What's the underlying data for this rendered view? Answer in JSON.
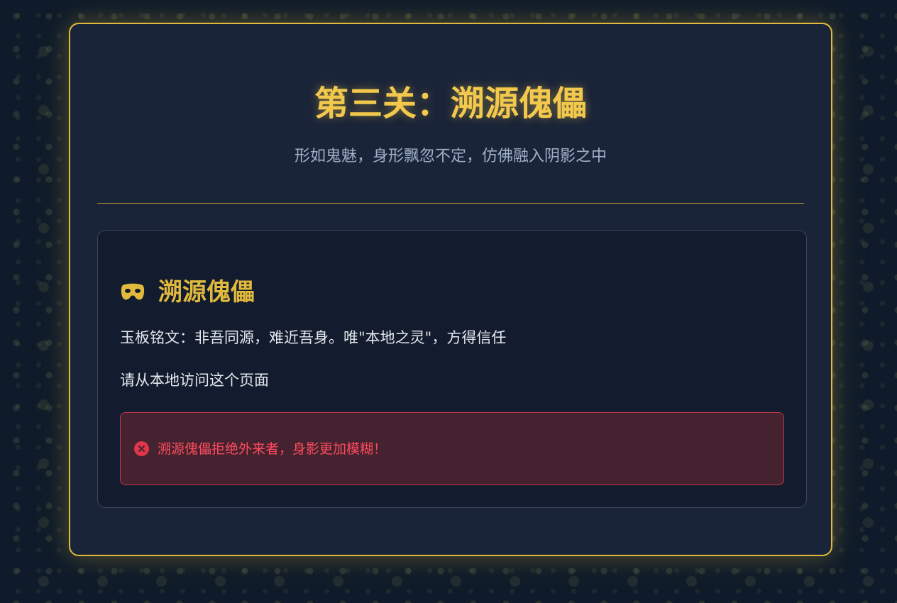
{
  "page": {
    "title": "第三关：溯源傀儡",
    "subtitle": "形如鬼魅，身形飘忽不定，仿佛融入阴影之中"
  },
  "panel": {
    "icon": "mask-icon",
    "title": "溯源傀儡",
    "inscription": "玉板铭文：非吾同源，难近吾身。唯\"本地之灵\"，方得信任",
    "hint": "请从本地访问这个页面",
    "alert": {
      "icon": "error-circle-icon",
      "text": "溯源傀儡拒绝外来者，身影更加模糊！"
    }
  },
  "colors": {
    "accent": "#e0b93d",
    "background": "#0f1b2a",
    "card": "#1a2438",
    "error": "#e0354a"
  }
}
